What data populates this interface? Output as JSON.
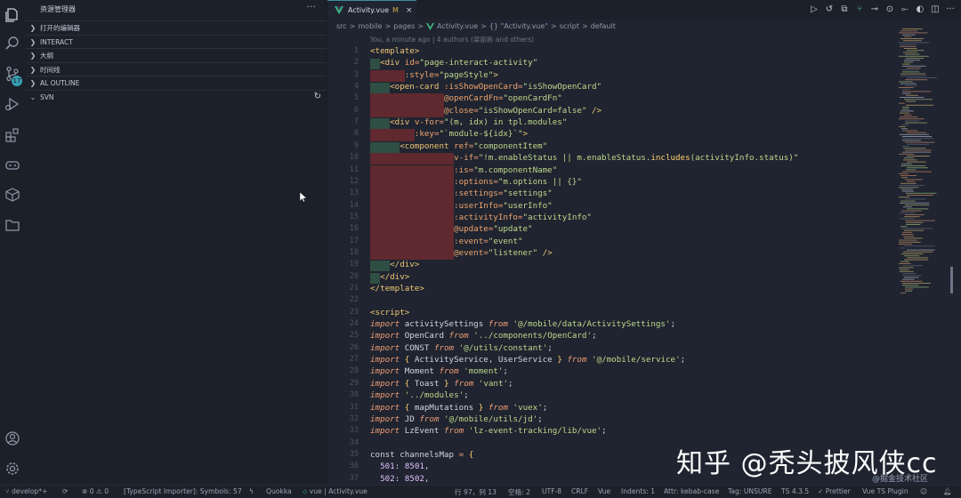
{
  "sidebar": {
    "title": "资源管理器",
    "more": "···",
    "sections": [
      {
        "label": "打开的编辑器"
      },
      {
        "label": "INTERACT"
      },
      {
        "label": "大纲"
      },
      {
        "label": "时间线"
      },
      {
        "label": "AL OUTLINE"
      },
      {
        "label": "SVN"
      }
    ],
    "scm_badge": "17"
  },
  "tab": {
    "label": "Activity.vue",
    "modified": "M",
    "close": "×"
  },
  "breadcrumb": {
    "parts": [
      "src",
      ">",
      "mobile",
      ">",
      "pages",
      ">",
      "Activity.vue",
      ">",
      "{} \"Activity.vue\"",
      ">",
      "script",
      ">",
      "default"
    ]
  },
  "blame": "You, a minute ago | 4 authors (梁丽彬 and others)",
  "code_lines": [
    {
      "n": "1",
      "html": "<span class='t-tag'>&lt;template&gt;</span>"
    },
    {
      "n": "2",
      "html": "  <span class='t-tag'>&lt;div</span> <span class='t-attr'>id</span><span class='t-op'>=</span><span class='t-str'>\"page-interact-activity\"</span>"
    },
    {
      "n": "3",
      "html": "       <span class='t-attr'>:style</span><span class='t-op'>=</span><span class='t-str'>\"pageStyle\"</span><span class='t-tag'>&gt;</span>"
    },
    {
      "n": "4",
      "html": "    <span class='t-tag'>&lt;open-card</span> <span class='t-attr'>:isShowOpenCard</span><span class='t-op'>=</span><span class='t-str'>\"isShowOpenCard\"</span>"
    },
    {
      "n": "5",
      "html": "               <span class='t-attr'>@openCardFn</span><span class='t-op'>=</span><span class='t-str'>\"openCardFn\"</span>"
    },
    {
      "n": "6",
      "html": "               <span class='t-attr'>@close</span><span class='t-op'>=</span><span class='t-str'>\"isShowOpenCard=false\"</span> <span class='t-tag'>/&gt;</span>"
    },
    {
      "n": "7",
      "html": "    <span class='t-tag'>&lt;div</span> <span class='t-attr'>v-for</span><span class='t-op'>=</span><span class='t-str'>\"(m, idx) in tpl.modules\"</span>"
    },
    {
      "n": "8",
      "html": "         <span class='t-attr'>:key</span><span class='t-op'>=</span><span class='t-str'>\"`module-${idx}`\"</span><span class='t-tag'>&gt;</span>"
    },
    {
      "n": "9",
      "html": "      <span class='t-tag'>&lt;component</span> <span class='t-attr'>ref</span><span class='t-op'>=</span><span class='t-str'>\"componentItem\"</span>"
    },
    {
      "n": "10",
      "html": "                 <span class='t-attr'>v-if</span><span class='t-op'>=</span><span class='t-str'>\"!m.enableStatus || m.enableStatus.<span class='t-fn'>includes</span>(activityInfo.status)\"</span>"
    },
    {
      "n": "11",
      "html": "                 <span class='t-attr'>:is</span><span class='t-op'>=</span><span class='t-str'>\"m.componentName\"</span>"
    },
    {
      "n": "12",
      "html": "                 <span class='t-attr'>:options</span><span class='t-op'>=</span><span class='t-str'>\"m.options || {}\"</span>"
    },
    {
      "n": "13",
      "html": "                 <span class='t-attr'>:settings</span><span class='t-op'>=</span><span class='t-str'>\"settings\"</span>"
    },
    {
      "n": "14",
      "html": "                 <span class='t-attr'>:userInfo</span><span class='t-op'>=</span><span class='t-str'>\"userInfo\"</span>"
    },
    {
      "n": "15",
      "html": "                 <span class='t-attr'>:activityInfo</span><span class='t-op'>=</span><span class='t-str'>\"activityInfo\"</span>"
    },
    {
      "n": "16",
      "html": "                 <span class='t-attr'>@update</span><span class='t-op'>=</span><span class='t-str'>\"update\"</span>"
    },
    {
      "n": "17",
      "html": "                 <span class='t-attr'>:event</span><span class='t-op'>=</span><span class='t-str'>\"event\"</span>"
    },
    {
      "n": "18",
      "html": "                 <span class='t-attr'>@event</span><span class='t-op'>=</span><span class='t-str'>\"listener\"</span> <span class='t-tag'>/&gt;</span>"
    },
    {
      "n": "19",
      "html": "    <span class='t-tag'>&lt;/div&gt;</span>"
    },
    {
      "n": "20",
      "html": "  <span class='t-tag'>&lt;/div&gt;</span>"
    },
    {
      "n": "21",
      "html": "<span class='t-tag'>&lt;/template&gt;</span>"
    },
    {
      "n": "22",
      "html": ""
    },
    {
      "n": "23",
      "html": "<span class='t-tag'>&lt;script&gt;</span>"
    },
    {
      "n": "24",
      "html": "<span class='t-kw'>import</span> activitySettings <span class='t-kw'>from</span> <span class='t-str'>'@/mobile/data/ActivitySettings'</span>;"
    },
    {
      "n": "25",
      "html": "<span class='t-kw'>import</span> OpenCard <span class='t-kw'>from</span> <span class='t-str'>'../components/OpenCard'</span>;"
    },
    {
      "n": "26",
      "html": "<span class='t-kw'>import</span> CONST <span class='t-kw'>from</span> <span class='t-str'>'@/utils/constant'</span>;"
    },
    {
      "n": "27",
      "html": "<span class='t-kw'>import</span> <span class='t-fn'>{</span> ActivityService, UserService <span class='t-fn'>}</span> <span class='t-kw'>from</span> <span class='t-str'>'@/mobile/service'</span>;"
    },
    {
      "n": "28",
      "html": "<span class='t-kw'>import</span> Moment <span class='t-kw'>from</span> <span class='t-str'>'moment'</span>;"
    },
    {
      "n": "29",
      "html": "<span class='t-kw'>import</span> <span class='t-fn'>{</span> Toast <span class='t-fn'>}</span> <span class='t-kw'>from</span> <span class='t-str'>'vant'</span>;"
    },
    {
      "n": "30",
      "html": "<span class='t-kw'>import</span> <span class='t-str'>'../modules'</span>;"
    },
    {
      "n": "31",
      "html": "<span class='t-kw'>import</span> <span class='t-fn'>{</span> mapMutations <span class='t-fn'>}</span> <span class='t-kw'>from</span> <span class='t-str'>'vuex'</span>;"
    },
    {
      "n": "32",
      "html": "<span class='t-kw'>import</span> JD <span class='t-kw'>from</span> <span class='t-str'>'@/mobile/utils/jd'</span>;"
    },
    {
      "n": "33",
      "html": "<span class='t-kw'>import</span> LzEvent <span class='t-kw'>from</span> <span class='t-str'>'lz-event-tracking/lib/vue'</span>;"
    },
    {
      "n": "34",
      "html": ""
    },
    {
      "n": "35",
      "html": "<span class='t-pl'>const</span> channelsMap <span class='t-op'>=</span> <span class='t-fn'>{</span>"
    },
    {
      "n": "36",
      "html": "  <span class='t-num'>501</span>: <span class='t-num'>8501</span>,"
    },
    {
      "n": "37",
      "html": "  <span class='t-num'>502</span>: <span class='t-num'>8502</span>,"
    }
  ],
  "watermark": {
    "big": "知乎 @秃头披风侠cc",
    "small": "@掘金技术社区"
  },
  "statusbar": {
    "branch": "develop*+",
    "sync": "⟳",
    "problems": "⊗ 0 ⚠ 0",
    "ts_importer": "[TypeScript Importer]: Symbols: 57",
    "quokka": "Quokka",
    "breadcrumb": "vue | Activity.vue",
    "position": "行 97，列 13",
    "spaces": "空格: 2",
    "encoding": "UTF-8",
    "eol": "CRLF",
    "language": "Vue",
    "indents": "Indents: 1",
    "attr": "Attr: kebab-case",
    "tag": "Tag: UNSURE",
    "ts_version": "TS 4.3.5",
    "prettier": "✓ Prettier",
    "plugin": "Vue TS Plugin"
  },
  "colors": {
    "accent": "#3c8d9c",
    "vue_green": "#41b883",
    "deleted_bg": "#6b2a2f",
    "added_bg": "#2f4e44"
  }
}
